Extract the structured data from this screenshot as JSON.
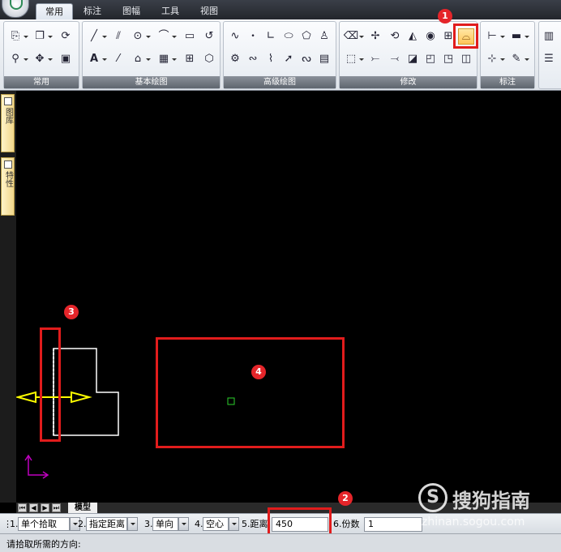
{
  "ribbon": {
    "tabs": [
      {
        "label": "常用",
        "active": true
      },
      {
        "label": "标注",
        "active": false
      },
      {
        "label": "图幅",
        "active": false
      },
      {
        "label": "工具",
        "active": false
      },
      {
        "label": "视图",
        "active": false
      }
    ],
    "groups": {
      "common": "常用",
      "basic_draw": "基本绘图",
      "advanced_draw": "高级绘图",
      "modify": "修改",
      "dimension": "标注"
    }
  },
  "left_palette": {
    "tab1": "图库",
    "tab2": "特性"
  },
  "callouts": {
    "c1": "1",
    "c2": "2",
    "c3": "3",
    "c4": "4"
  },
  "model_tab": "模型",
  "command_options": {
    "opt1_label": "1.",
    "opt1_value": "单个拾取",
    "opt2_label": "2.",
    "opt2_value": "指定距离",
    "opt3_label": "3.",
    "opt3_value": "单向",
    "opt4_label": "4.",
    "opt4_value": "空心",
    "opt5_label": "5.距离",
    "distance_value": "450",
    "opt6_label": "6.份数",
    "count_value": "1"
  },
  "status": {
    "prompt": "请拾取所需的方向:"
  },
  "watermark": {
    "logo": "S",
    "title": "搜狗指南",
    "url": "zhinan.sogou.com"
  },
  "colors": {
    "callout_red": "#e11c1c",
    "canvas": "#000000",
    "arrow_yellow": "#ffff00",
    "ucs_magenta": "#c000c0",
    "pickbox_green": "#2bd12b"
  }
}
